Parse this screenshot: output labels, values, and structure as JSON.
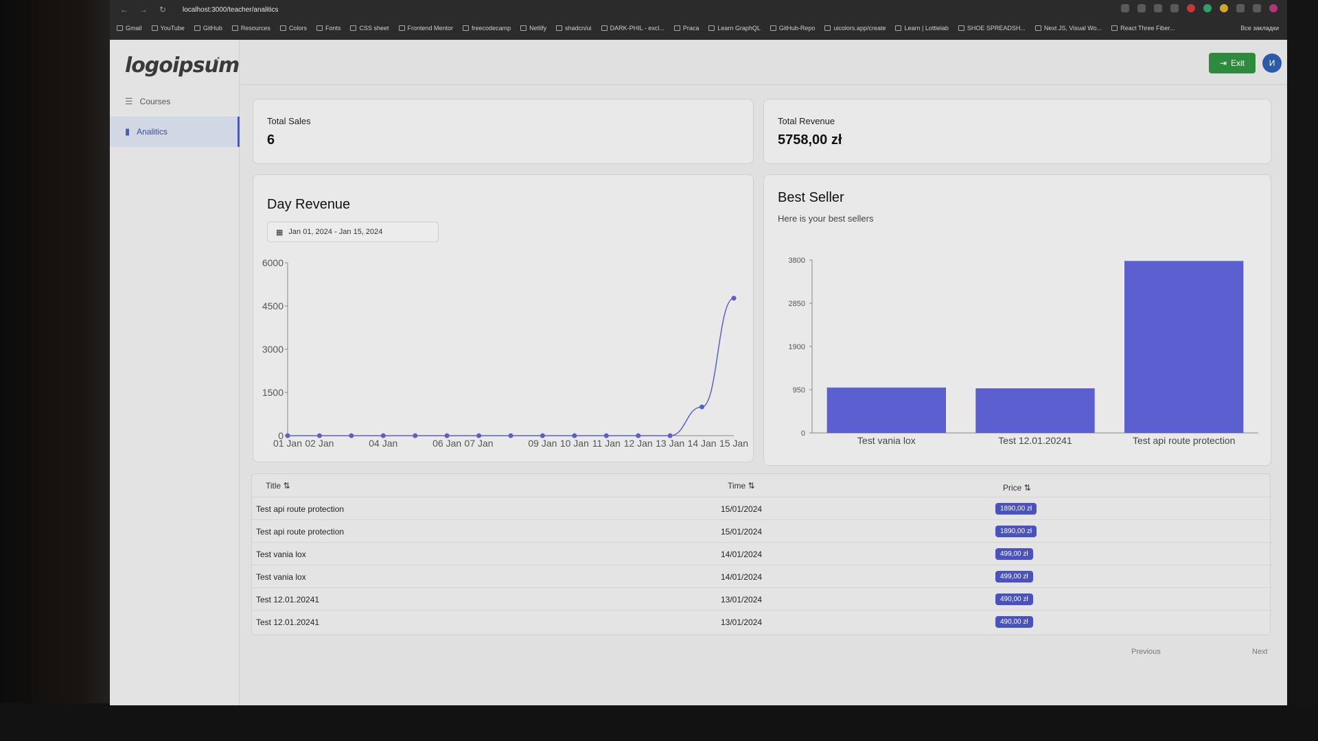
{
  "browser": {
    "url": "localhost:3000/teacher/analitics",
    "bookmarks": [
      "Gmail",
      "YouTube",
      "GitHub",
      "Resources",
      "Colors",
      "Fonts",
      "CSS sheet",
      "Frontend Mentor",
      "freecodecamp",
      "Netlify",
      "shadcn/ui",
      "DARK-PHIL - excl...",
      "Praca",
      "Learn GraphQL",
      "GitHub-Repo",
      "uicolors.app/create",
      "Learn | Lottielab",
      "SHOE SPREADSH...",
      "Next JS, Visual Wo...",
      "React Three Fiber..."
    ],
    "bookmarks_right": "Все закладки"
  },
  "sidebar": {
    "logo": "logoipsum",
    "items": [
      {
        "label": "Courses",
        "icon": "list-icon",
        "active": false
      },
      {
        "label": "Analitics",
        "icon": "bar-chart-icon",
        "active": true
      }
    ]
  },
  "header": {
    "exit_label": "Exit",
    "avatar_initial": "И"
  },
  "stats": {
    "total_sales_label": "Total Sales",
    "total_sales_value": "6",
    "total_revenue_label": "Total Revenue",
    "total_revenue_value": "5758,00 zł"
  },
  "day_revenue": {
    "title": "Day Revenue",
    "date_range": "Jan 01, 2024 - Jan 15, 2024"
  },
  "best_seller": {
    "title": "Best Seller",
    "subtitle": "Here is your best sellers"
  },
  "chart_data": [
    {
      "type": "line",
      "title": "Day Revenue",
      "x": [
        "01 Jan",
        "02 Jan",
        "03 Jan",
        "04 Jan",
        "05 Jan",
        "06 Jan",
        "07 Jan",
        "08 Jan",
        "09 Jan",
        "10 Jan",
        "11 Jan",
        "12 Jan",
        "13 Jan",
        "14 Jan",
        "15 Jan"
      ],
      "x_tick_labels": [
        "01 Jan",
        "02 Jan",
        "04 Jan",
        "06 Jan",
        "07 Jan",
        "09 Jan",
        "10 Jan",
        "11 Jan",
        "12 Jan",
        "13 Jan",
        "14 Jan",
        "15 Jan"
      ],
      "values": [
        0,
        0,
        0,
        0,
        0,
        0,
        0,
        0,
        0,
        0,
        0,
        0,
        0,
        998,
        4770
      ],
      "yticks": [
        0,
        1500,
        3000,
        4500,
        6000
      ],
      "ylim": [
        0,
        6000
      ],
      "color": "#5b5fc7"
    },
    {
      "type": "bar",
      "title": "Best Seller",
      "categories": [
        "Test vania lox",
        "Test 12.01.20241",
        "Test api route protection"
      ],
      "values": [
        998,
        980,
        3780
      ],
      "yticks": [
        0,
        950,
        1900,
        2850,
        3800
      ],
      "ylim": [
        0,
        3800
      ],
      "color": "#5b5fcf"
    }
  ],
  "table": {
    "headers": {
      "title": "Title",
      "time": "Time",
      "price": "Price"
    },
    "rows": [
      {
        "title": "Test api route protection",
        "time": "15/01/2024",
        "price": "1890,00 zł"
      },
      {
        "title": "Test api route protection",
        "time": "15/01/2024",
        "price": "1890,00 zł"
      },
      {
        "title": "Test vania lox",
        "time": "14/01/2024",
        "price": "499,00 zł"
      },
      {
        "title": "Test vania lox",
        "time": "14/01/2024",
        "price": "499,00 zł"
      },
      {
        "title": "Test 12.01.20241",
        "time": "13/01/2024",
        "price": "490,00 zł"
      },
      {
        "title": "Test 12.01.20241",
        "time": "13/01/2024",
        "price": "490,00 zł"
      }
    ],
    "previous_label": "Previous",
    "next_label": "Next"
  }
}
